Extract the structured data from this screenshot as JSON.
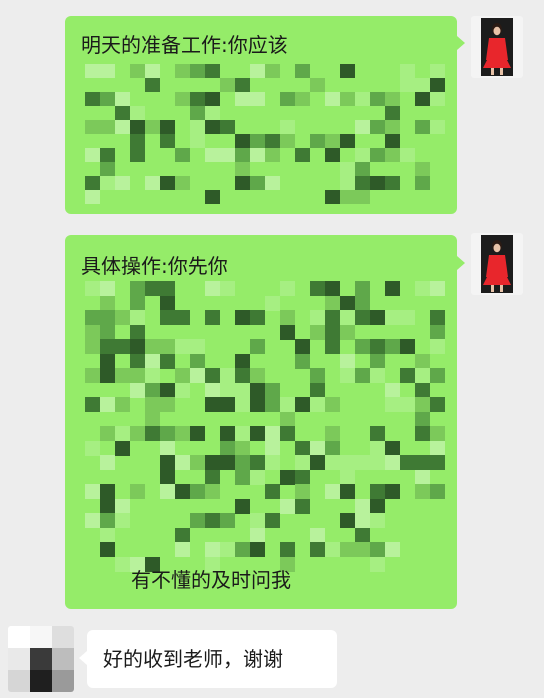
{
  "conversation": {
    "messages": [
      {
        "sender": "self",
        "text": "明天的准备工作:你应该",
        "redacted": true
      },
      {
        "sender": "self",
        "text": "具体操作:你先你",
        "text_after_redaction": "有不懂的及时问我",
        "redacted": true
      },
      {
        "sender": "other",
        "text": "好的收到老师，谢谢"
      }
    ]
  },
  "colors": {
    "background": "#ededed",
    "self_bubble": "#95ec69",
    "other_bubble": "#ffffff",
    "avatar_dress": "#e8262c",
    "mosaic_dark": "#2e5a28",
    "mosaic_mid": "#5fa84a"
  }
}
